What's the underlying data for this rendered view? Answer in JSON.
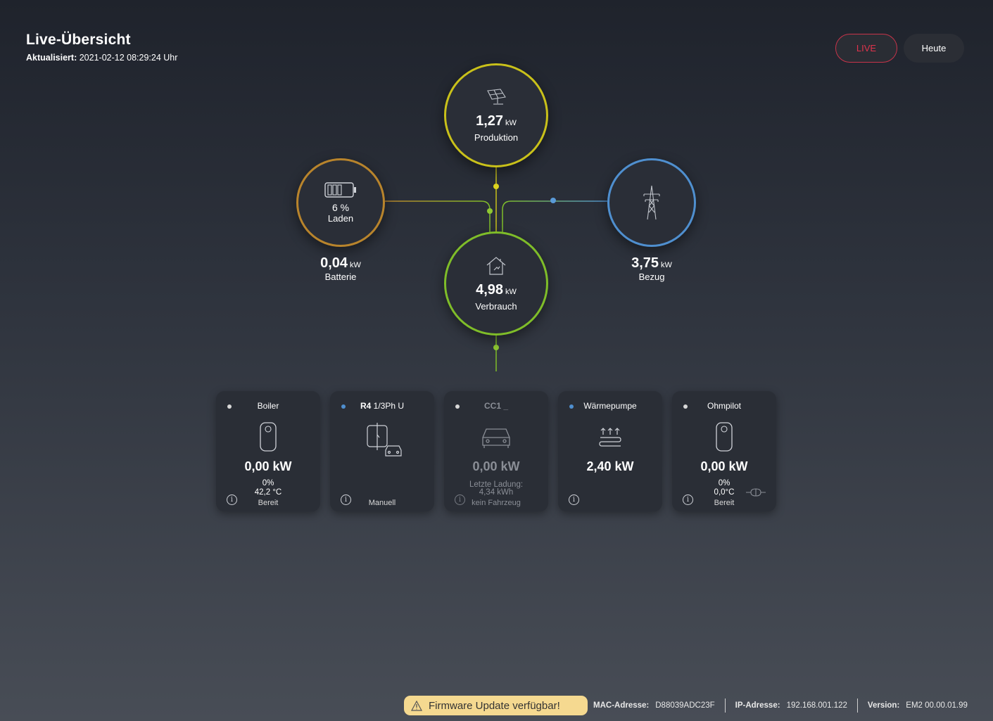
{
  "header": {
    "title": "Live-Übersicht",
    "updated_label": "Aktualisiert:",
    "updated_value": "2021-02-12 08:29:24 Uhr"
  },
  "buttons": {
    "live": "LIVE",
    "today": "Heute"
  },
  "colors": {
    "production": "#c9c11a",
    "battery": "#b8842c",
    "grid": "#4f8fcf",
    "consumption": "#7fbd29",
    "live_accent": "#e0334c",
    "banner": "#f5d990"
  },
  "nodes": {
    "production": {
      "icon": "solar-panel-icon",
      "value": "1,27",
      "unit": "kW",
      "label": "Produktion"
    },
    "battery": {
      "icon": "battery-icon",
      "percent": "6 %",
      "state": "Laden",
      "value": "0,04",
      "unit": "kW",
      "label": "Batterie"
    },
    "grid": {
      "icon": "power-pylon-icon",
      "value": "3,75",
      "unit": "kW",
      "label": "Bezug"
    },
    "consumption": {
      "icon": "house-icon",
      "value": "4,98",
      "unit": "kW",
      "label": "Verbrauch"
    }
  },
  "devices": [
    {
      "name": "Boiler",
      "icon": "boiler-icon",
      "value": "0,00 kW",
      "sub1": "0%",
      "sub2": "42,2 °C",
      "state": "Bereit",
      "dot": "#d8d8d8"
    },
    {
      "name_bold": "R4",
      "name": "1/3Ph U",
      "icon": "wallbox-car-icon",
      "state": "Manuell",
      "dot": "#4f8fcf"
    },
    {
      "name": "CC1 _",
      "icon": "car-icon",
      "value": "0,00 kW",
      "sub1": "Letzte Ladung:",
      "sub2": "4,34 kWh",
      "state": "kein Fahrzeug",
      "dot": "#d8d8d8"
    },
    {
      "name": "Wärmepumpe",
      "icon": "heat-pump-icon",
      "value": "2,40 kW",
      "dot": "#4f8fcf"
    },
    {
      "name": "Ohmpilot",
      "icon": "boiler-icon",
      "value": "0,00 kW",
      "sub1": "0%",
      "sub2": "0,0°C",
      "state": "Bereit",
      "dot": "#d8d8d8"
    }
  ],
  "footer": {
    "firmware": "Firmware Update verfügbar!",
    "mac_label": "MAC-Adresse:",
    "mac": "D88039ADC23F",
    "ip_label": "IP-Adresse:",
    "ip": "192.168.001.122",
    "version_label": "Version:",
    "version": "EM2 00.00.01.99"
  }
}
